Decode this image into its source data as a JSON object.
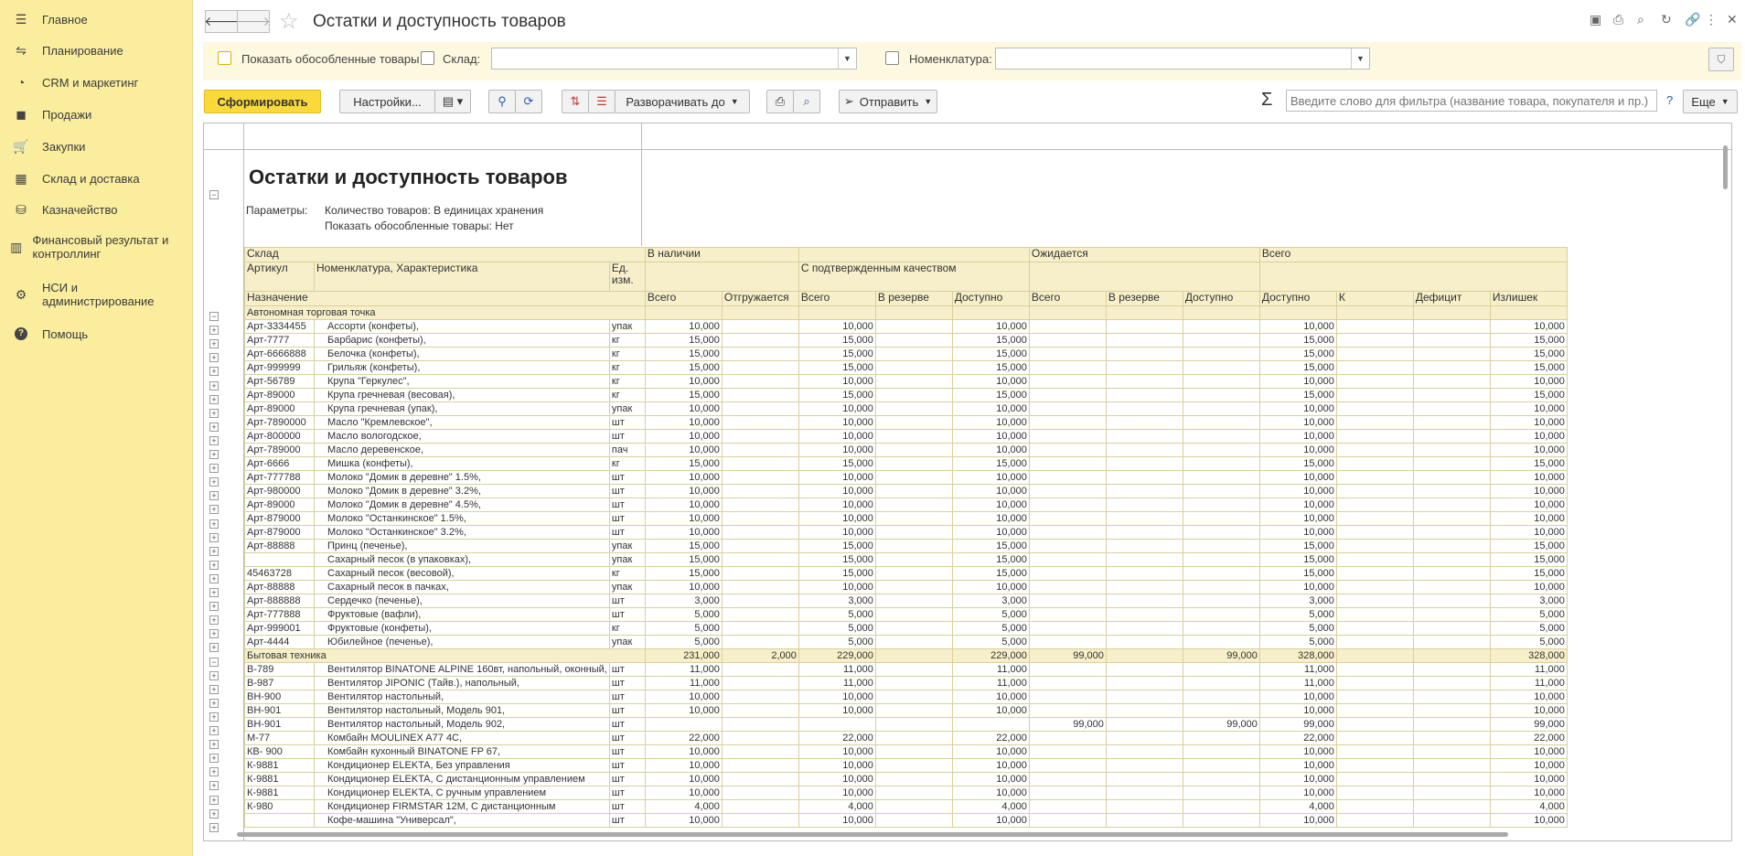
{
  "sidebar": {
    "items": [
      {
        "label": "Главное",
        "icon": "menu-icon"
      },
      {
        "label": "Планирование",
        "icon": "planning-icon"
      },
      {
        "label": "CRM и маркетинг",
        "icon": "crm-icon"
      },
      {
        "label": "Продажи",
        "icon": "bag-icon"
      },
      {
        "label": "Закупки",
        "icon": "cart-icon"
      },
      {
        "label": "Склад и доставка",
        "icon": "warehouse-icon"
      },
      {
        "label": "Казначейство",
        "icon": "coins-icon"
      },
      {
        "label": "Финансовый результат и контроллинг",
        "icon": "chart-icon"
      },
      {
        "label": "НСИ и администрирование",
        "icon": "gear-icon"
      },
      {
        "label": "Помощь",
        "icon": "help-icon"
      }
    ]
  },
  "header": {
    "title": "Остатки и доступность товаров"
  },
  "filters": {
    "show_separate_label": "Показать обособленные товары",
    "warehouse_label": "Склад:",
    "warehouse_value": "",
    "nomenclature_label": "Номенклатура:",
    "nomenclature_value": ""
  },
  "toolbar": {
    "generate_label": "Сформировать",
    "settings_label": "Настройки...",
    "expand_label": "Разворачивать до",
    "send_label": "Отправить",
    "search_placeholder": "Введите слово для фильтра (название товара, покупателя и пр.)",
    "help_label": "?",
    "more_label": "Еще",
    "sigma_label": "Σ"
  },
  "report": {
    "title": "Остатки и доступность товаров",
    "params_label": "Параметры:",
    "param1": "Количество товаров: В единицах хранения",
    "param2": "Показать обособленные товары: Нет",
    "headers": {
      "warehouse": "Склад",
      "article": "Артикул",
      "nomenclature": "Номенклатура, Характеристика",
      "unit": "Ед. изм.",
      "purpose": "Назначение",
      "in_stock": "В наличии",
      "confirmed_quality": "С подтвержденным качеством",
      "expected": "Ожидается",
      "total": "Всего",
      "sub": [
        "Всего",
        "Отгружается",
        "Всего",
        "В резерве",
        "Доступно",
        "Всего",
        "В резерве",
        "Доступно",
        "Доступно",
        "К",
        "Дефицит",
        "Излишек"
      ]
    },
    "groups": [
      {
        "name": "Автономная торговая точка",
        "totals": [
          "",
          "",
          "",
          "",
          "",
          "",
          "",
          "",
          "",
          "",
          "",
          ""
        ],
        "rows": [
          [
            "Арт-3334455",
            "Ассорти (конфеты),",
            "упак",
            "10,000",
            "",
            "10,000",
            "",
            "10,000",
            "",
            "",
            "",
            "10,000",
            "",
            "",
            "10,000"
          ],
          [
            "Арт-7777",
            "Барбарис (конфеты),",
            "кг",
            "15,000",
            "",
            "15,000",
            "",
            "15,000",
            "",
            "",
            "",
            "15,000",
            "",
            "",
            "15,000"
          ],
          [
            "Арт-6666888",
            "Белочка (конфеты),",
            "кг",
            "15,000",
            "",
            "15,000",
            "",
            "15,000",
            "",
            "",
            "",
            "15,000",
            "",
            "",
            "15,000"
          ],
          [
            "Арт-999999",
            "Грильяж (конфеты),",
            "кг",
            "15,000",
            "",
            "15,000",
            "",
            "15,000",
            "",
            "",
            "",
            "15,000",
            "",
            "",
            "15,000"
          ],
          [
            "Арт-56789",
            "Крупа \"Геркулес\",",
            "кг",
            "10,000",
            "",
            "10,000",
            "",
            "10,000",
            "",
            "",
            "",
            "10,000",
            "",
            "",
            "10,000"
          ],
          [
            "Арт-89000",
            "Крупа гречневая (весовая),",
            "кг",
            "15,000",
            "",
            "15,000",
            "",
            "15,000",
            "",
            "",
            "",
            "15,000",
            "",
            "",
            "15,000"
          ],
          [
            "Арт-89000",
            "Крупа гречневая (упак),",
            "упак",
            "10,000",
            "",
            "10,000",
            "",
            "10,000",
            "",
            "",
            "",
            "10,000",
            "",
            "",
            "10,000"
          ],
          [
            "Арт-7890000",
            "Масло \"Кремлевское\",",
            "шт",
            "10,000",
            "",
            "10,000",
            "",
            "10,000",
            "",
            "",
            "",
            "10,000",
            "",
            "",
            "10,000"
          ],
          [
            "Арт-800000",
            "Масло вологодское,",
            "шт",
            "10,000",
            "",
            "10,000",
            "",
            "10,000",
            "",
            "",
            "",
            "10,000",
            "",
            "",
            "10,000"
          ],
          [
            "Арт-789000",
            "Масло деревенское,",
            "пач",
            "10,000",
            "",
            "10,000",
            "",
            "10,000",
            "",
            "",
            "",
            "10,000",
            "",
            "",
            "10,000"
          ],
          [
            "Арт-6666",
            "Мишка (конфеты),",
            "кг",
            "15,000",
            "",
            "15,000",
            "",
            "15,000",
            "",
            "",
            "",
            "15,000",
            "",
            "",
            "15,000"
          ],
          [
            "Арт-777788",
            "Молоко \"Домик в деревне\" 1.5%,",
            "шт",
            "10,000",
            "",
            "10,000",
            "",
            "10,000",
            "",
            "",
            "",
            "10,000",
            "",
            "",
            "10,000"
          ],
          [
            "Арт-980000",
            "Молоко \"Домик в деревне\" 3.2%,",
            "шт",
            "10,000",
            "",
            "10,000",
            "",
            "10,000",
            "",
            "",
            "",
            "10,000",
            "",
            "",
            "10,000"
          ],
          [
            "Арт-89000",
            "Молоко \"Домик в деревне\" 4.5%,",
            "шт",
            "10,000",
            "",
            "10,000",
            "",
            "10,000",
            "",
            "",
            "",
            "10,000",
            "",
            "",
            "10,000"
          ],
          [
            "Арт-879000",
            "Молоко \"Останкинское\" 1.5%,",
            "шт",
            "10,000",
            "",
            "10,000",
            "",
            "10,000",
            "",
            "",
            "",
            "10,000",
            "",
            "",
            "10,000"
          ],
          [
            "Арт-879000",
            "Молоко \"Останкинское\" 3.2%,",
            "шт",
            "10,000",
            "",
            "10,000",
            "",
            "10,000",
            "",
            "",
            "",
            "10,000",
            "",
            "",
            "10,000"
          ],
          [
            "Арт-88888",
            "Принц (печенье),",
            "упак",
            "15,000",
            "",
            "15,000",
            "",
            "15,000",
            "",
            "",
            "",
            "15,000",
            "",
            "",
            "15,000"
          ],
          [
            "",
            "Сахарный песок (в упаковках),",
            "упак",
            "15,000",
            "",
            "15,000",
            "",
            "15,000",
            "",
            "",
            "",
            "15,000",
            "",
            "",
            "15,000"
          ],
          [
            "45463728",
            "Сахарный песок (весовой),",
            "кг",
            "15,000",
            "",
            "15,000",
            "",
            "15,000",
            "",
            "",
            "",
            "15,000",
            "",
            "",
            "15,000"
          ],
          [
            "Арт-88888",
            "Сахарный песок в пачках,",
            "упак",
            "10,000",
            "",
            "10,000",
            "",
            "10,000",
            "",
            "",
            "",
            "10,000",
            "",
            "",
            "10,000"
          ],
          [
            "Арт-888888",
            "Сердечко (печенье),",
            "шт",
            "3,000",
            "",
            "3,000",
            "",
            "3,000",
            "",
            "",
            "",
            "3,000",
            "",
            "",
            "3,000"
          ],
          [
            "Арт-777888",
            "Фруктовые (вафли),",
            "шт",
            "5,000",
            "",
            "5,000",
            "",
            "5,000",
            "",
            "",
            "",
            "5,000",
            "",
            "",
            "5,000"
          ],
          [
            "Арт-999001",
            "Фруктовые (конфеты),",
            "кг",
            "5,000",
            "",
            "5,000",
            "",
            "5,000",
            "",
            "",
            "",
            "5,000",
            "",
            "",
            "5,000"
          ],
          [
            "Арт-4444",
            "Юбилейное (печенье),",
            "упак",
            "5,000",
            "",
            "5,000",
            "",
            "5,000",
            "",
            "",
            "",
            "5,000",
            "",
            "",
            "5,000"
          ]
        ]
      },
      {
        "name": "Бытовая техника",
        "totals": [
          "231,000",
          "2,000",
          "229,000",
          "",
          "229,000",
          "99,000",
          "",
          "99,000",
          "328,000",
          "",
          "",
          "328,000"
        ],
        "rows": [
          [
            "В-789",
            "Вентилятор BINATONE ALPINE 160вт, напольный, оконный,",
            "шт",
            "11,000",
            "",
            "11,000",
            "",
            "11,000",
            "",
            "",
            "",
            "11,000",
            "",
            "",
            "11,000"
          ],
          [
            "В-987",
            "Вентилятор JIPONIC (Тайв.), напольный,",
            "шт",
            "11,000",
            "",
            "11,000",
            "",
            "11,000",
            "",
            "",
            "",
            "11,000",
            "",
            "",
            "11,000"
          ],
          [
            "ВН-900",
            "Вентилятор настольный,",
            "шт",
            "10,000",
            "",
            "10,000",
            "",
            "10,000",
            "",
            "",
            "",
            "10,000",
            "",
            "",
            "10,000"
          ],
          [
            "ВН-901",
            "Вентилятор настольный, Модель 901,",
            "шт",
            "10,000",
            "",
            "10,000",
            "",
            "10,000",
            "",
            "",
            "",
            "10,000",
            "",
            "",
            "10,000"
          ],
          [
            "ВН-901",
            "Вентилятор настольный, Модель 902,",
            "шт",
            "",
            "",
            "",
            "",
            "",
            "99,000",
            "",
            "99,000",
            "99,000",
            "",
            "",
            "99,000"
          ],
          [
            "М-77",
            "Комбайн MOULINEX  A77 4C,",
            "шт",
            "22,000",
            "",
            "22,000",
            "",
            "22,000",
            "",
            "",
            "",
            "22,000",
            "",
            "",
            "22,000"
          ],
          [
            "КВ- 900",
            "Комбайн кухонный BINATONE FP 67,",
            "шт",
            "10,000",
            "",
            "10,000",
            "",
            "10,000",
            "",
            "",
            "",
            "10,000",
            "",
            "",
            "10,000"
          ],
          [
            "К-9881",
            "Кондиционер ELEKTA, Без управления",
            "шт",
            "10,000",
            "",
            "10,000",
            "",
            "10,000",
            "",
            "",
            "",
            "10,000",
            "",
            "",
            "10,000"
          ],
          [
            "К-9881",
            "Кондиционер ELEKTA, С дистанционным управлением",
            "шт",
            "10,000",
            "",
            "10,000",
            "",
            "10,000",
            "",
            "",
            "",
            "10,000",
            "",
            "",
            "10,000"
          ],
          [
            "К-9881",
            "Кондиционер ELEKTA, С ручным управлением",
            "шт",
            "10,000",
            "",
            "10,000",
            "",
            "10,000",
            "",
            "",
            "",
            "10,000",
            "",
            "",
            "10,000"
          ],
          [
            "К-980",
            "Кондиционер FIRMSTAR 12M, С дистанционным",
            "шт",
            "4,000",
            "",
            "4,000",
            "",
            "4,000",
            "",
            "",
            "",
            "4,000",
            "",
            "",
            "4,000"
          ],
          [
            "",
            "Кофе-машина \"Универсал\",",
            "шт",
            "10,000",
            "",
            "10,000",
            "",
            "10,000",
            "",
            "",
            "",
            "10,000",
            "",
            "",
            "10,000"
          ]
        ]
      }
    ]
  },
  "colors": {
    "sidebar_bg": "#fbed9e",
    "primary_button": "#fcd93b",
    "group_row_bg": "#f6efc9"
  }
}
